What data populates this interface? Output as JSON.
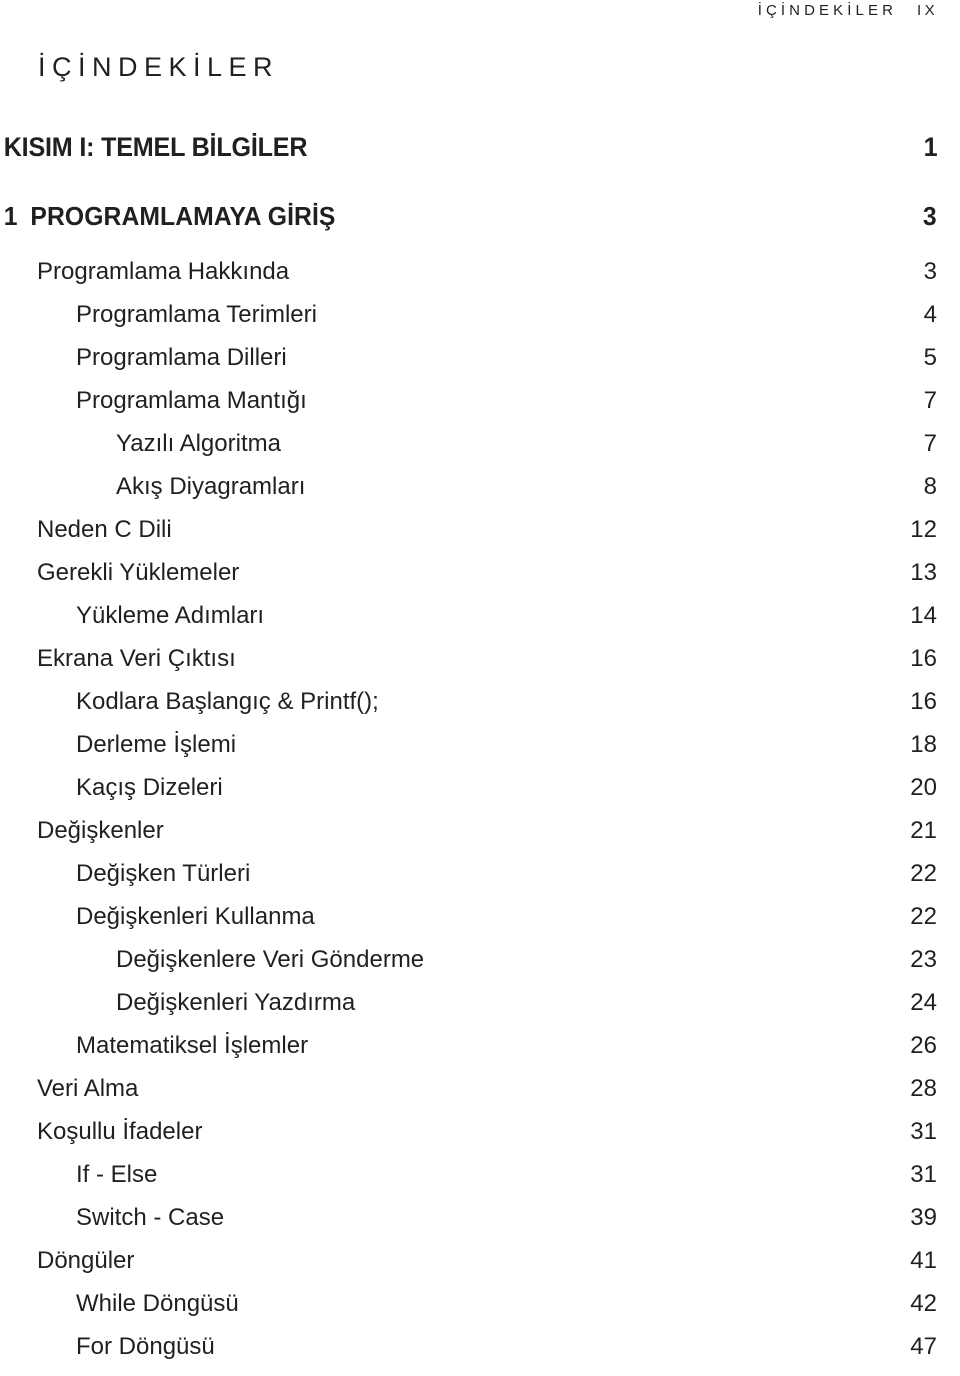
{
  "running_header": {
    "title": "İÇİNDEKİLER",
    "folio": "IX"
  },
  "page_title": "İÇİNDEKİLER",
  "toc": {
    "part": {
      "label": "KISIM I: TEMEL BİLGİLER",
      "page": "1"
    },
    "chapter": {
      "number": "1",
      "label": "PROGRAMLAMAYA GİRİŞ",
      "page": "3"
    },
    "entries": [
      {
        "label": "Programlama Hakkında",
        "page": "3",
        "level": 1
      },
      {
        "label": "Programlama Terimleri",
        "page": "4",
        "level": 2
      },
      {
        "label": "Programlama Dilleri",
        "page": "5",
        "level": 2
      },
      {
        "label": "Programlama Mantığı",
        "page": "7",
        "level": 2
      },
      {
        "label": "Yazılı Algoritma",
        "page": "7",
        "level": 3
      },
      {
        "label": "Akış Diyagramları",
        "page": "8",
        "level": 3
      },
      {
        "label": "Neden C Dili",
        "page": "12",
        "level": 1
      },
      {
        "label": "Gerekli Yüklemeler",
        "page": "13",
        "level": 1
      },
      {
        "label": "Yükleme Adımları",
        "page": "14",
        "level": 2
      },
      {
        "label": "Ekrana Veri Çıktısı",
        "page": "16",
        "level": 1
      },
      {
        "label": "Kodlara Başlangıç & Printf();",
        "page": "16",
        "level": 2
      },
      {
        "label": "Derleme İşlemi",
        "page": "18",
        "level": 2
      },
      {
        "label": "Kaçış Dizeleri",
        "page": "20",
        "level": 2
      },
      {
        "label": "Değişkenler",
        "page": "21",
        "level": 1
      },
      {
        "label": "Değişken Türleri",
        "page": "22",
        "level": 2
      },
      {
        "label": "Değişkenleri Kullanma",
        "page": "22",
        "level": 2
      },
      {
        "label": "Değişkenlere Veri Gönderme",
        "page": "23",
        "level": 3
      },
      {
        "label": "Değişkenleri Yazdırma",
        "page": "24",
        "level": 3
      },
      {
        "label": "Matematiksel İşlemler",
        "page": "26",
        "level": 2
      },
      {
        "label": "Veri Alma",
        "page": "28",
        "level": 1
      },
      {
        "label": "Koşullu İfadeler",
        "page": "31",
        "level": 1
      },
      {
        "label": "If - Else",
        "page": "31",
        "level": 2
      },
      {
        "label": "Switch - Case",
        "page": "39",
        "level": 2
      },
      {
        "label": "Döngüler",
        "page": "41",
        "level": 1
      },
      {
        "label": "While Döngüsü",
        "page": "42",
        "level": 2
      },
      {
        "label": "For Döngüsü",
        "page": "47",
        "level": 2
      }
    ]
  },
  "colors": {
    "text": "#231f20",
    "background": "#ffffff"
  }
}
